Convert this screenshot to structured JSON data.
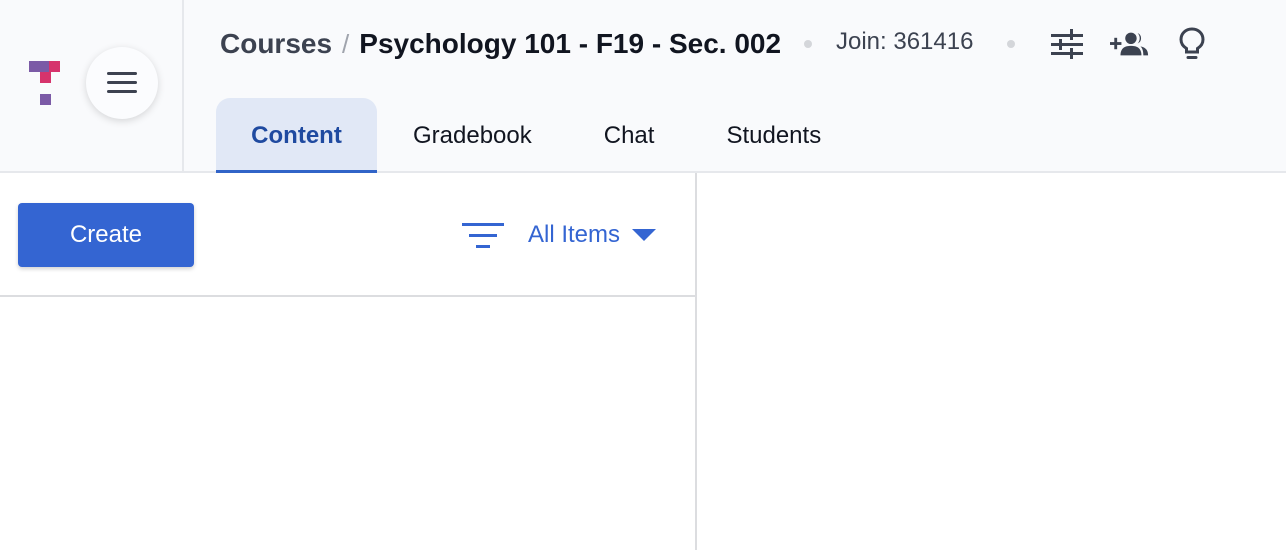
{
  "app": {
    "logo": "tophat-logo",
    "brand_colors": {
      "purple": "#7b5aa6",
      "pink": "#d6336c"
    },
    "menu_icon": "hamburger-menu-icon"
  },
  "header": {
    "breadcrumb": {
      "root": "Courses",
      "separator": "/",
      "current": "Psychology 101 - F19 - Sec. 002"
    },
    "join_code": "Join: 361416",
    "actions": [
      {
        "icon": "sliders-settings-icon",
        "label": "Course settings"
      },
      {
        "icon": "add-people-icon",
        "label": "Invite students"
      },
      {
        "icon": "lightbulb-icon",
        "label": "Tips"
      }
    ],
    "tabs": [
      {
        "label": "Content",
        "active": true
      },
      {
        "label": "Gradebook",
        "active": false
      },
      {
        "label": "Chat",
        "active": false
      },
      {
        "label": "Students",
        "active": false
      }
    ]
  },
  "content": {
    "create_label": "Create",
    "filter": {
      "icon": "filter-icon",
      "selected": "All Items"
    }
  },
  "colors": {
    "accent": "#3465d2",
    "active_tab_bg": "#e1e8f6",
    "active_tab_text": "#1f4aa0",
    "header_bg": "#f9fafc"
  }
}
